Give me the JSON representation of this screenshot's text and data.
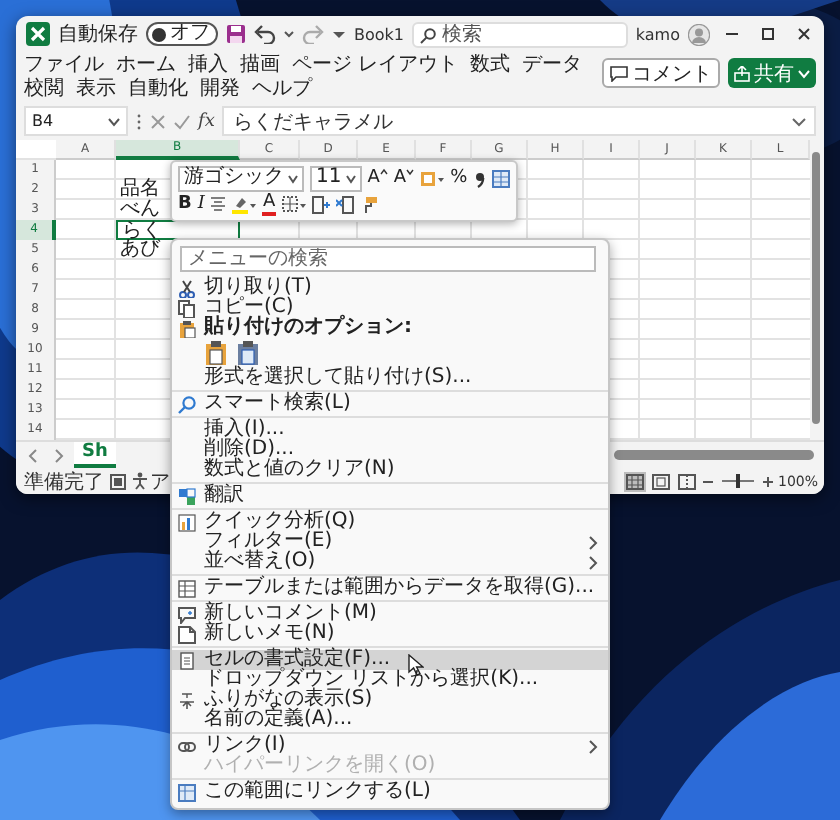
{
  "window": {
    "title": "Book1"
  },
  "title_bar": {
    "autosave_label": "自動保存",
    "autosave": {
      "on": false,
      "label": "オフ"
    },
    "search": {
      "placeholder": "検索"
    },
    "user": "kamo"
  },
  "ribbon_tabs": [
    {
      "label": "ファイル",
      "selected": false
    },
    {
      "label": "ホーム",
      "selected": false
    },
    {
      "label": "挿入",
      "selected": false
    },
    {
      "label": "描画",
      "selected": false
    },
    {
      "label": "ページ レイアウト",
      "selected": false
    },
    {
      "label": "数式",
      "selected": false
    },
    {
      "label": "データ",
      "selected": false
    },
    {
      "label": "校閲",
      "selected": false
    },
    {
      "label": "表示",
      "selected": false
    },
    {
      "label": "自動化",
      "selected": false
    },
    {
      "label": "開発",
      "selected": false
    },
    {
      "label": "ヘルプ",
      "selected": false
    }
  ],
  "ribbon_buttons": [
    {
      "kind": "comment",
      "label": "コメント"
    },
    {
      "kind": "share",
      "label": "共有"
    }
  ],
  "formula_bar": {
    "name_box": "B4",
    "function_label": "fx",
    "value": "らくだキャラメル"
  },
  "sheet": {
    "columns": [
      {
        "label": "A",
        "selected": false
      },
      {
        "label": "B",
        "selected": true
      },
      {
        "label": "C",
        "selected": false
      },
      {
        "label": "D",
        "selected": false
      },
      {
        "label": "E",
        "selected": false
      },
      {
        "label": "F",
        "selected": false
      },
      {
        "label": "G",
        "selected": false
      },
      {
        "label": "H",
        "selected": false
      },
      {
        "label": "I",
        "selected": false
      },
      {
        "label": "J",
        "selected": false
      },
      {
        "label": "K",
        "selected": false
      },
      {
        "label": "L",
        "selected": false
      }
    ],
    "rows": [
      {
        "label": "1",
        "selected": false
      },
      {
        "label": "2",
        "selected": false,
        "cells": {
          "B": "品名"
        }
      },
      {
        "label": "3",
        "selected": false,
        "cells": {
          "B": "べん"
        }
      },
      {
        "label": "4",
        "selected": true,
        "cells": {
          "B": "らく"
        }
      },
      {
        "label": "5",
        "selected": false,
        "cells": {
          "B": "あび"
        }
      },
      {
        "label": "6",
        "selected": false
      },
      {
        "label": "7",
        "selected": false
      },
      {
        "label": "8",
        "selected": false
      },
      {
        "label": "9",
        "selected": false
      },
      {
        "label": "10",
        "selected": false
      },
      {
        "label": "11",
        "selected": false
      },
      {
        "label": "12",
        "selected": false
      },
      {
        "label": "13",
        "selected": false
      },
      {
        "label": "14",
        "selected": false
      }
    ]
  },
  "sheet_tabs": [
    {
      "label": "Sh",
      "selected": true
    }
  ],
  "status_bar": {
    "text": "準備完了",
    "accessibility": "ア",
    "views": [
      {
        "selected": true
      },
      {
        "selected": false
      },
      {
        "selected": false
      }
    ],
    "zoom": {
      "level": 0.5,
      "reading": "100%"
    }
  },
  "mini_toolbar": {
    "font": "游ゴシック",
    "size": "11",
    "grow_font": "A",
    "shrink_font": "A",
    "percent": "%",
    "bold": "B",
    "italic": "I",
    "font_color": "A"
  },
  "context_menu": {
    "search": {
      "placeholder": "メニューの検索"
    },
    "groups": [
      [
        {
          "kind": "item",
          "label": "切り取り(T)",
          "submenu": false,
          "disabled": false,
          "highlighted": false
        },
        {
          "kind": "item",
          "label": "コピー(C)",
          "submenu": false,
          "disabled": false,
          "highlighted": false
        },
        {
          "kind": "header",
          "label": "貼り付けのオプション:",
          "submenu": false,
          "disabled": false,
          "highlighted": false
        },
        {
          "kind": "paste_icons",
          "submenu": false,
          "disabled": false,
          "highlighted": false
        },
        {
          "kind": "item",
          "label": "形式を選択して貼り付け(S)...",
          "submenu": false,
          "disabled": false,
          "highlighted": false
        }
      ],
      [
        {
          "kind": "item",
          "label": "スマート検索(L)",
          "submenu": false,
          "disabled": false,
          "highlighted": false
        }
      ],
      [
        {
          "kind": "item",
          "label": "挿入(I)...",
          "submenu": false,
          "disabled": false,
          "highlighted": false
        },
        {
          "kind": "item",
          "label": "削除(D)...",
          "submenu": false,
          "disabled": false,
          "highlighted": false
        },
        {
          "kind": "item",
          "label": "数式と値のクリア(N)",
          "submenu": false,
          "disabled": false,
          "highlighted": false
        }
      ],
      [
        {
          "kind": "item",
          "label": "翻訳",
          "submenu": false,
          "disabled": false,
          "highlighted": false
        }
      ],
      [
        {
          "kind": "item",
          "label": "クイック分析(Q)",
          "submenu": false,
          "disabled": false,
          "highlighted": false
        },
        {
          "kind": "item",
          "label": "フィルター(E)",
          "submenu": true,
          "disabled": false,
          "highlighted": false
        },
        {
          "kind": "item",
          "label": "並べ替え(O)",
          "submenu": true,
          "disabled": false,
          "highlighted": false
        }
      ],
      [
        {
          "kind": "item",
          "label": "テーブルまたは範囲からデータを取得(G)...",
          "submenu": false,
          "disabled": false,
          "highlighted": false
        }
      ],
      [
        {
          "kind": "item",
          "label": "新しいコメント(M)",
          "submenu": false,
          "disabled": false,
          "highlighted": false
        },
        {
          "kind": "item",
          "label": "新しいメモ(N)",
          "submenu": false,
          "disabled": false,
          "highlighted": false
        }
      ],
      [
        {
          "kind": "item",
          "label": "セルの書式設定(F)...",
          "submenu": false,
          "disabled": false,
          "highlighted": true
        },
        {
          "kind": "item",
          "label": "ドロップダウン リストから選択(K)...",
          "submenu": false,
          "disabled": false,
          "highlighted": false
        },
        {
          "kind": "item",
          "label": "ふりがなの表示(S)",
          "submenu": false,
          "disabled": false,
          "highlighted": false
        },
        {
          "kind": "item",
          "label": "名前の定義(A)...",
          "submenu": false,
          "disabled": false,
          "highlighted": false
        }
      ],
      [
        {
          "kind": "item",
          "label": "リンク(I)",
          "submenu": true,
          "disabled": false,
          "highlighted": false
        },
        {
          "kind": "item",
          "label": "ハイパーリンクを開く(O)",
          "submenu": false,
          "disabled": true,
          "highlighted": false
        }
      ],
      [
        {
          "kind": "item",
          "label": "この範囲にリンクする(L)",
          "submenu": false,
          "disabled": false,
          "highlighted": false
        }
      ]
    ]
  }
}
